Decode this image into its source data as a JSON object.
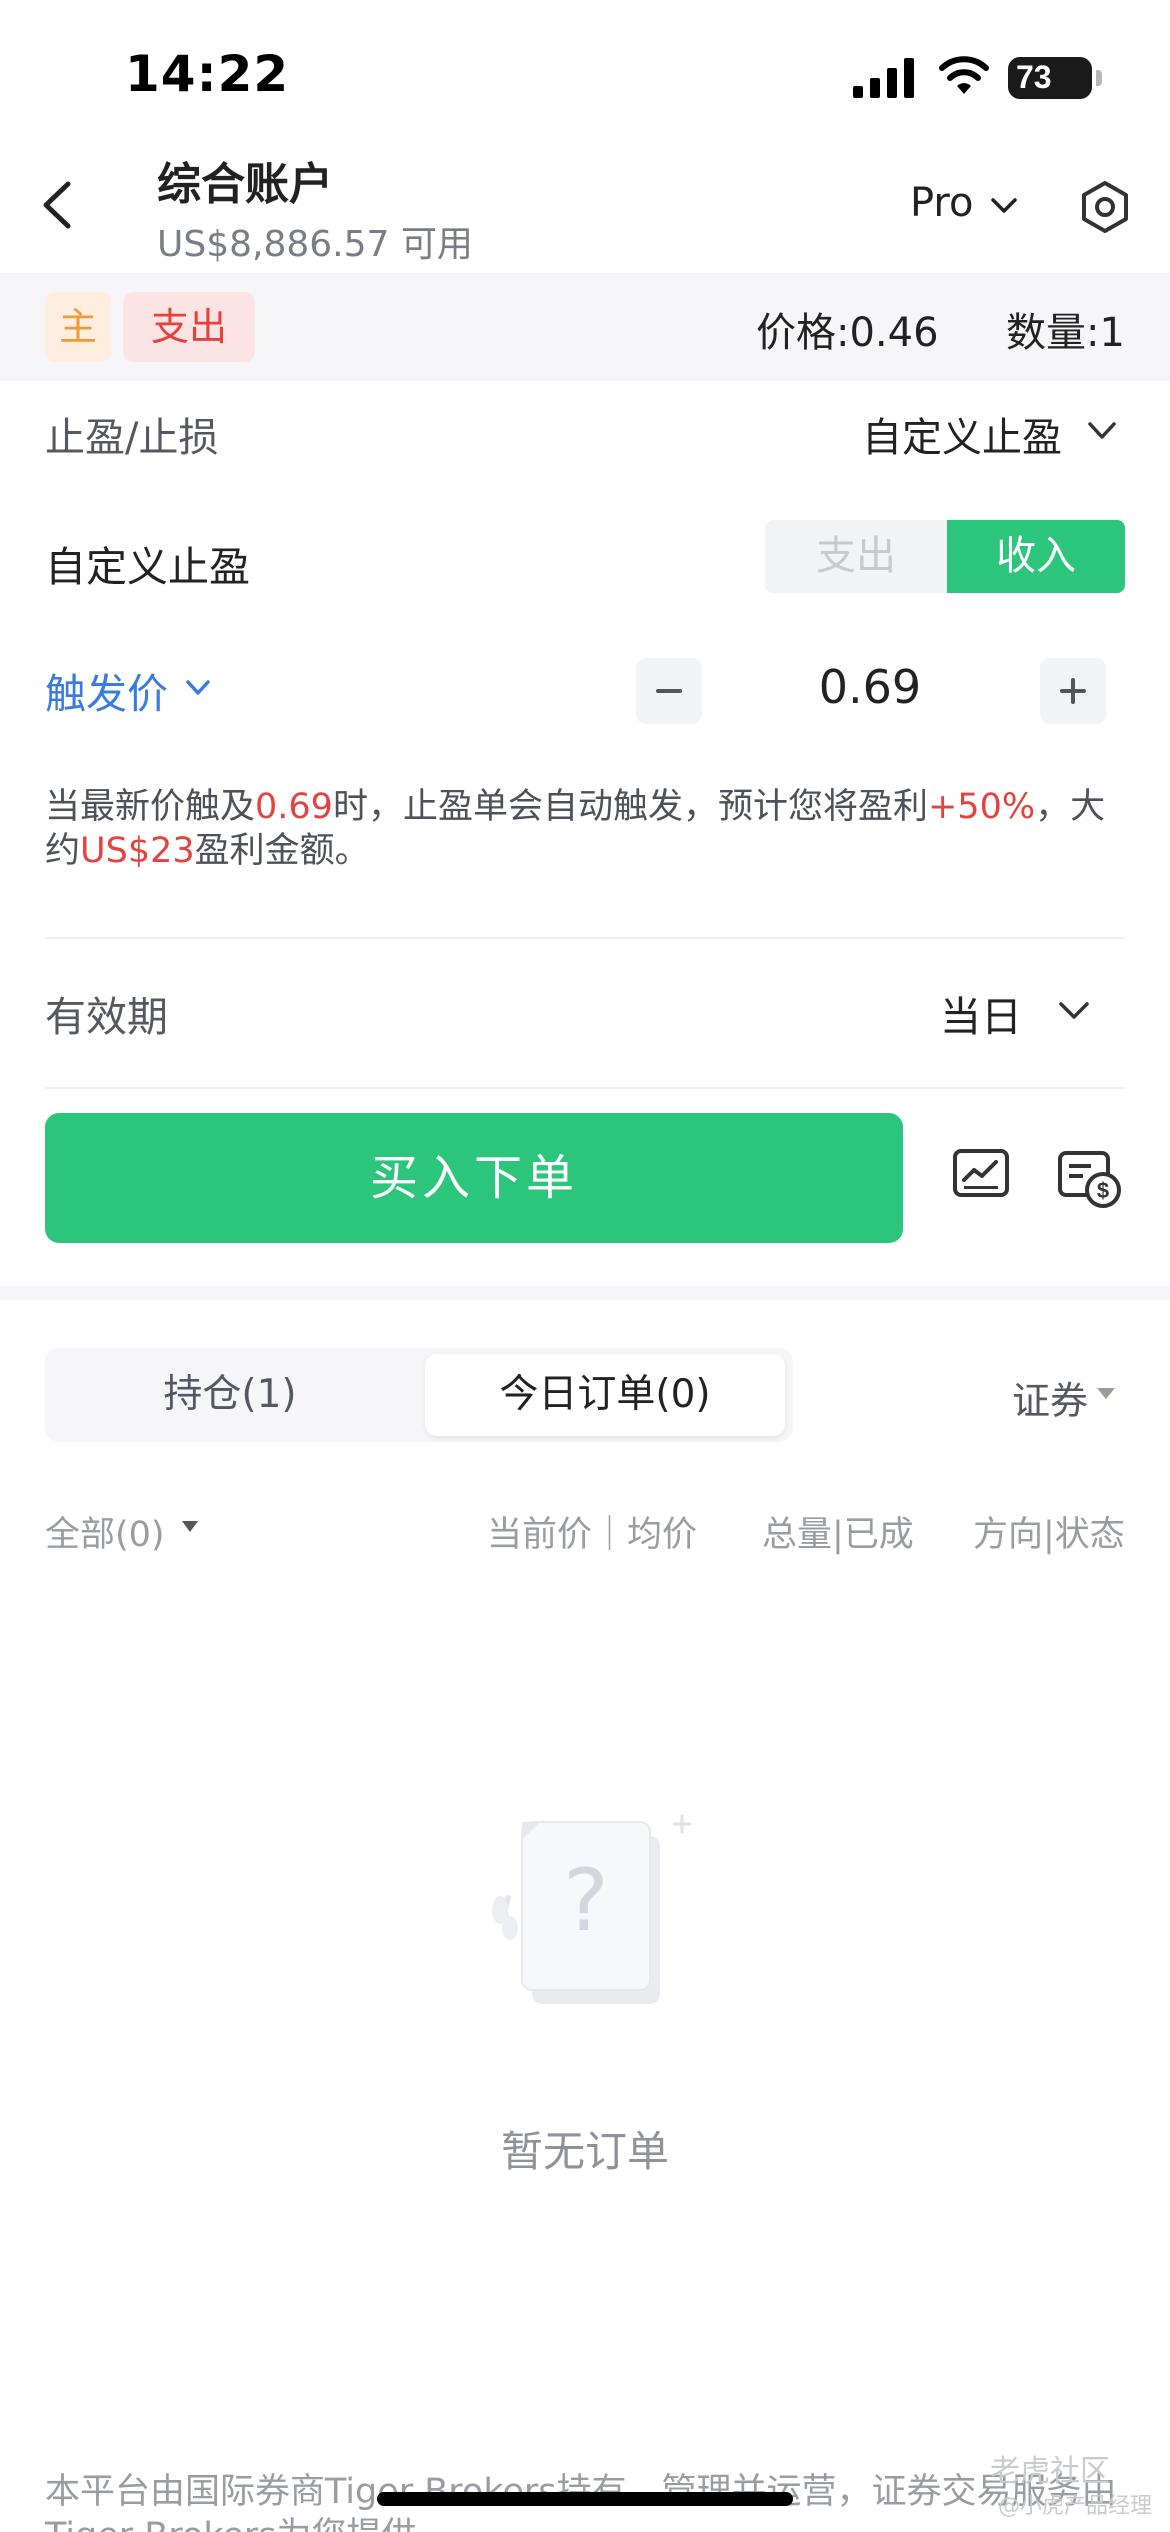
{
  "status_bar": {
    "time": "14:22",
    "battery": "73"
  },
  "header": {
    "title": "综合账户",
    "available": "US$8,886.57 可用",
    "mode": "Pro"
  },
  "order_band": {
    "tag_main": "主",
    "tag_side": "支出",
    "price": "价格:0.46",
    "quantity": "数量:1"
  },
  "tpsl": {
    "label": "止盈/止损",
    "value": "自定义止盈"
  },
  "custom": {
    "label": "自定义止盈",
    "segment_off": "支出",
    "segment_on": "收入"
  },
  "trigger": {
    "label": "触发价",
    "value": "0.69"
  },
  "hint": {
    "p1": "当最新价触及",
    "price": "0.69",
    "p2": "时，止盈单会自动触发，预计您将盈利",
    "pct": "+50%",
    "p3": "，大约",
    "amount": "US$23",
    "p4": "盈利金额。"
  },
  "validity": {
    "label": "有效期",
    "value": "当日"
  },
  "buy_button": "买入下单",
  "tabs": {
    "positions": "持仓(1)",
    "today_orders": "今日订单(0)",
    "securities": "证券"
  },
  "filters": {
    "all": "全部(0)",
    "col_price": "当前价｜均价",
    "col_qty": "总量|已成",
    "col_dir": "方向|状态"
  },
  "empty_state": "暂无订单",
  "footer": "本平台由国际券商Tiger Brokers持有、管理并运营，证券交易服务由Tiger Brokers为您提供",
  "watermark": {
    "line1": "老虎社区",
    "line2": "@小虎产品经理"
  },
  "colors": {
    "accent_green": "#2bc57b",
    "alert_red": "#e2433f",
    "link_blue": "#3b7be0"
  }
}
